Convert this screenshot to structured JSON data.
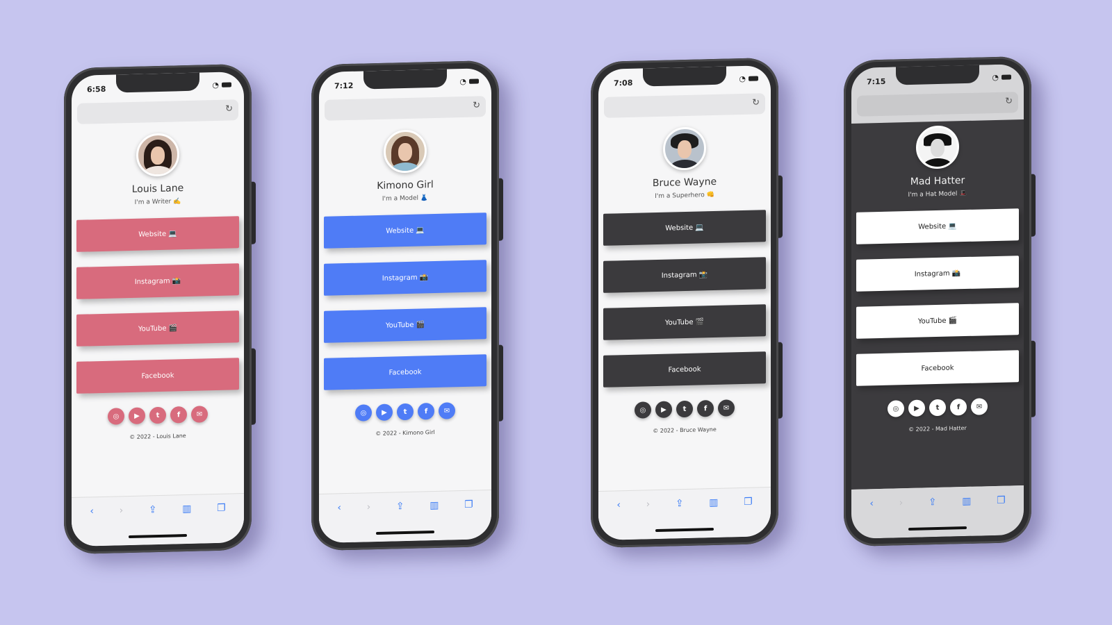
{
  "colors": {
    "background": "#c6c5ef",
    "pink": "#d86b7d",
    "blue": "#4f7cf6",
    "dark": "#3b3a3d",
    "white": "#ffffff"
  },
  "phones": [
    {
      "time": "6:58",
      "name": "Louis Lane",
      "tagline": "I'm a Writer ✍️",
      "buttons": [
        "Website 💻",
        "Instagram 📸",
        "YouTube 🎬",
        "Facebook"
      ],
      "footer": "© 2022 - Louis Lane",
      "social_icons": [
        "instagram-icon",
        "youtube-icon",
        "twitter-icon",
        "facebook-icon",
        "email-icon"
      ]
    },
    {
      "time": "7:12",
      "name": "Kimono Girl",
      "tagline": "I'm a Model 👗",
      "buttons": [
        "Website 💻",
        "Instagram 📸",
        "YouTube 🎬",
        "Facebook"
      ],
      "footer": "© 2022 - Kimono Girl",
      "social_icons": [
        "instagram-icon",
        "youtube-icon",
        "twitter-icon",
        "facebook-icon",
        "email-icon"
      ]
    },
    {
      "time": "7:08",
      "name": "Bruce Wayne",
      "tagline": "I'm a Superhero 👊",
      "buttons": [
        "Website 💻",
        "Instagram 📸",
        "YouTube 🎬",
        "Facebook"
      ],
      "footer": "© 2022 - Bruce Wayne",
      "social_icons": [
        "instagram-icon",
        "youtube-icon",
        "twitter-icon",
        "facebook-icon",
        "email-icon"
      ]
    },
    {
      "time": "7:15",
      "name": "Mad Hatter",
      "tagline": "I'm a Hat Model 🎩",
      "buttons": [
        "Website 💻",
        "Instagram 📸",
        "YouTube 🎬",
        "Facebook"
      ],
      "footer": "© 2022 - Mad Hatter",
      "social_icons": [
        "instagram-icon",
        "youtube-icon",
        "twitter-icon",
        "facebook-icon",
        "email-icon"
      ]
    }
  ]
}
